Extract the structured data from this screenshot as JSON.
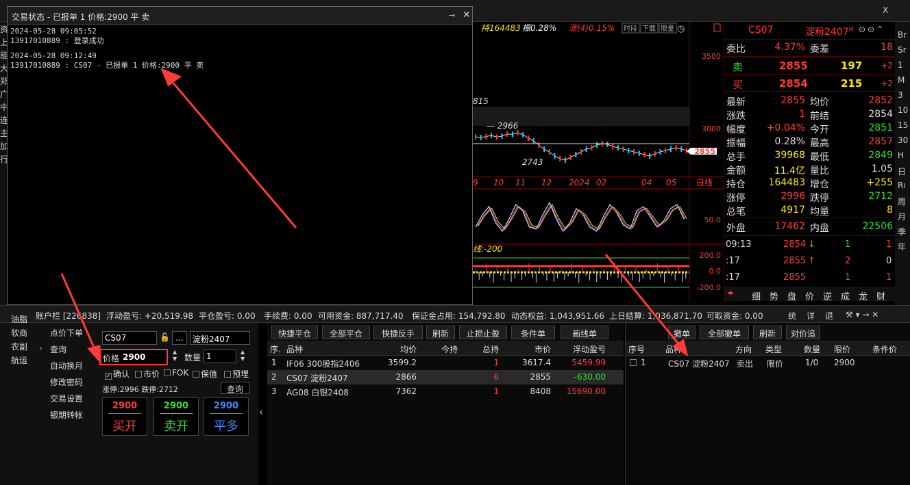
{
  "top": {
    "close_glyph": "X"
  },
  "left_nav": [
    "资",
    "上",
    "能",
    "大",
    "郑",
    "广",
    "中",
    "连",
    "主",
    "加",
    "行"
  ],
  "chart": {
    "header": [
      "持164483",
      "振0.28%",
      "涨(4)0.15%"
    ],
    "header_buttons": [
      "时段",
      "下载",
      "限量"
    ],
    "price_labels": [
      "3500",
      "3000"
    ],
    "marks": [
      "815",
      "2966",
      "2743"
    ],
    "current_price": "2855",
    "months": [
      "9",
      "10",
      "11",
      "12",
      "2024",
      "02",
      "04",
      "05"
    ],
    "period": "日线",
    "kdj_label": "50.0",
    "macd_text": "线:-200",
    "macd_labels": [
      "200.0",
      "0.0",
      "-200.0"
    ],
    "kline_x": [
      0,
      1,
      2,
      3,
      4,
      5,
      6,
      7,
      8,
      9,
      10,
      11,
      12,
      13,
      14,
      15,
      16,
      17,
      18,
      19,
      20,
      21,
      22,
      23,
      24,
      25,
      26,
      27,
      28,
      29,
      30,
      31,
      32,
      33,
      34,
      35,
      36,
      37,
      38,
      39,
      40
    ],
    "kline_y": [
      2960,
      2955,
      2962,
      2970,
      2958,
      2965,
      2980,
      2978,
      2990,
      2975,
      2950,
      2930,
      2900,
      2870,
      2850,
      2820,
      2800,
      2790,
      2810,
      2830,
      2850,
      2870,
      2880,
      2900,
      2910,
      2905,
      2890,
      2880,
      2870,
      2860,
      2850,
      2840,
      2830,
      2820,
      2835,
      2850,
      2860,
      2870,
      2880,
      2870,
      2860
    ],
    "kdj_k": [
      30,
      60,
      80,
      40,
      20,
      50,
      85,
      70,
      30,
      25,
      60,
      90,
      50,
      20,
      40,
      75,
      60,
      30,
      20,
      55,
      85,
      65,
      35,
      25,
      70,
      80,
      55,
      30,
      45,
      75,
      85,
      50
    ]
  },
  "quote": {
    "code": "CS07",
    "name": "淀粉2407",
    "name_sup": "M",
    "weibi_label": "委比",
    "weibi": "4.37%",
    "weicha_label": "委差",
    "weicha": "18",
    "ask_label": "卖",
    "ask_price": "2855",
    "ask_vol": "197",
    "ask_delta": "+2",
    "bid_label": "买",
    "bid_price": "2854",
    "bid_vol": "215",
    "bid_delta": "+2",
    "rows": [
      {
        "l1": "最新",
        "v1": "2855",
        "c1": "red",
        "l2": "均价",
        "v2": "2852",
        "c2": "red"
      },
      {
        "l1": "涨跌",
        "v1": "1",
        "c1": "red",
        "l2": "前结",
        "v2": "2854",
        "c2": "white"
      },
      {
        "l1": "幅度",
        "v1": "+0.04%",
        "c1": "red",
        "l2": "今开",
        "v2": "2851",
        "c2": "green"
      },
      {
        "l1": "振幅",
        "v1": "0.28%",
        "c1": "white",
        "l2": "最高",
        "v2": "2857",
        "c2": "red"
      },
      {
        "l1": "总手",
        "v1": "39968",
        "c1": "yellow",
        "l2": "最低",
        "v2": "2849",
        "c2": "green"
      },
      {
        "l1": "金额",
        "v1": "11.4亿",
        "c1": "yellow",
        "l2": "量比",
        "v2": "1.05",
        "c2": "white"
      },
      {
        "l1": "持仓",
        "v1": "164483",
        "c1": "yellow",
        "l2": "增仓",
        "v2": "+255",
        "c2": "yellow"
      },
      {
        "l1": "涨停",
        "v1": "2996",
        "c1": "red",
        "l2": "跌停",
        "v2": "2712",
        "c2": "green"
      },
      {
        "l1": "总笔",
        "v1": "4917",
        "c1": "yellow",
        "l2": "均量",
        "v2": "8",
        "c2": "yellow"
      }
    ],
    "outer_label": "外盘",
    "outer": "17462",
    "inner_label": "内盘",
    "inner": "22506",
    "ticks": [
      {
        "t": "09:13",
        "p": "2854",
        "dir": "↓",
        "dc": "green",
        "v": "1",
        "vc": "green",
        "n": "1",
        "nc": "red"
      },
      {
        "t": ":17",
        "p": "2855",
        "dir": "↑",
        "dc": "red",
        "v": "2",
        "vc": "red",
        "n": "0",
        "nc": "white"
      },
      {
        "t": ":17",
        "p": "2855",
        "dir": "",
        "dc": "red",
        "v": "1",
        "vc": "red",
        "n": "1",
        "nc": "red"
      }
    ],
    "tabs": [
      "细",
      "势",
      "盘",
      "价",
      "逆",
      "成",
      "龙",
      "财"
    ]
  },
  "far_right": [
    "Br",
    "Sr",
    "1",
    "M",
    "3",
    "10",
    "15",
    "30",
    "H",
    "日",
    "Rı",
    "周",
    "月",
    "季",
    "年"
  ],
  "dialog": {
    "title": "交易状态 - 已报单 1 价格:2900 平 卖",
    "log": [
      {
        "time": "2024-05-28 09:05:52",
        "msg": "13917010889 : 登录成功"
      },
      {
        "time": "2024-05-28 09:12:49",
        "msg": "13917010889 : CS07 - 已报单 1 价格:2900 平 卖"
      }
    ]
  },
  "account": {
    "label": "账户栏 [226838]",
    "float_pl": "浮动盈亏: +20,519.98",
    "close_pl": "平仓盈亏: 0.00",
    "fee": "手续费: 0.00",
    "avail": "可用资金: 887,717.40",
    "margin": "保证金占用: 154,792.80",
    "equity": "动态权益: 1,043,951.66",
    "prev": "上日结算: 1,036,871.70",
    "withdraw": "可取资金: 0.00",
    "icons": [
      "统",
      "详",
      "退"
    ]
  },
  "bottom_nav": {
    "groups": [
      "油脂",
      "软商",
      "农副",
      "航运"
    ],
    "items": [
      "点价下单",
      "查询",
      "自动换月",
      "修改密码",
      "交易设置",
      "银期转帐"
    ]
  },
  "form": {
    "code": "CS07",
    "name": "淀粉2407",
    "price_label": "价格",
    "price": "2900",
    "qty_label": "数量",
    "qty": "1",
    "checks": [
      {
        "label": "确认",
        "checked": true
      },
      {
        "label": "市价",
        "checked": false
      },
      {
        "label": "FOK",
        "checked": false
      },
      {
        "label": "保值",
        "checked": false
      },
      {
        "label": "预埋",
        "checked": false
      }
    ],
    "limits": "涨停:2996 跌停:2712",
    "query": "查询",
    "buy_open": {
      "price": "2900",
      "label": "买开"
    },
    "sell_open": {
      "price": "2900",
      "label": "卖开"
    },
    "close_long": {
      "price": "2900",
      "label": "平多"
    }
  },
  "positions": {
    "buttons": [
      "快捷平仓",
      "全部平仓",
      "快捷反手",
      "刷新",
      "止损止盈",
      "条件单",
      "画线单"
    ],
    "headers": [
      "序.",
      "品种",
      "均价",
      "今持",
      "总持",
      "市价",
      "浮动盈亏"
    ],
    "rows": [
      {
        "no": "1",
        "name": "IF06 300股指2406",
        "avg": "3599.2",
        "today": "",
        "total": "1",
        "mkt": "3617.4",
        "pl": "5459.99",
        "plc": "red"
      },
      {
        "no": "2",
        "name": "CS07 淀粉2407",
        "avg": "2866",
        "today": "",
        "total": "6",
        "mkt": "2855",
        "pl": "-630.00",
        "plc": "green"
      },
      {
        "no": "3",
        "name": "AG08 白银2408",
        "avg": "7362",
        "today": "",
        "total": "1",
        "mkt": "8408",
        "pl": "15690.00",
        "plc": "red"
      }
    ]
  },
  "orders": {
    "buttons": [
      "撤单",
      "全部撤单",
      "刷新",
      "对价追"
    ],
    "headers": [
      "序号",
      "品种",
      "方向",
      "类型",
      "数量",
      "限价",
      "条件价"
    ],
    "rows": [
      {
        "no": "1",
        "name": "CS07 淀粉2407",
        "dir": "卖出",
        "type": "限价",
        "qty": "1/0",
        "price": "2900",
        "cond": ""
      }
    ]
  },
  "colors": {
    "accent_red": "#ff3b3b",
    "accent_green": "#2ee02e",
    "accent_yellow": "#ffea00",
    "annotation": "#ff3a3a"
  }
}
